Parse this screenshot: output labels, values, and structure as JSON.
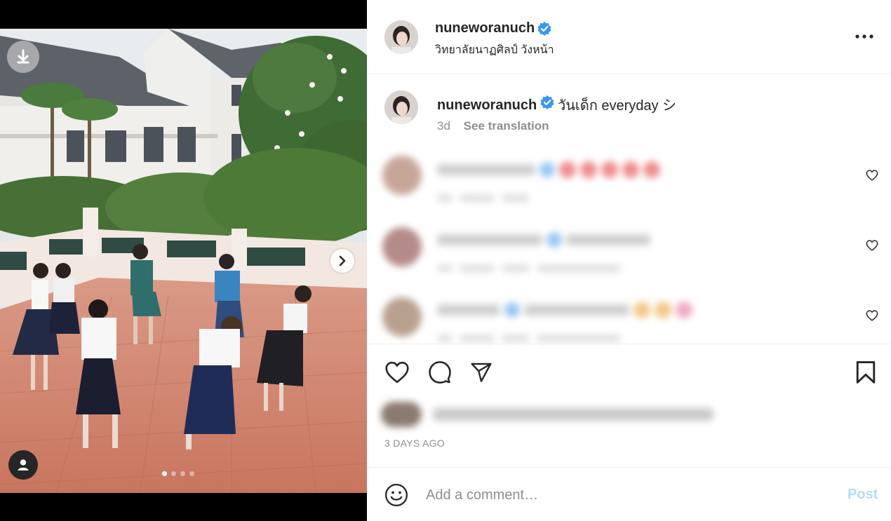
{
  "post": {
    "username": "nuneworanuch",
    "location": "วิทยาลัยนาฏศิลป์ วังหน้า",
    "caption": "วันเด็ก everyday シ",
    "time": "3d",
    "see_translation": "See translation",
    "posted_ago": "3 DAYS AGO"
  },
  "media": {
    "carousel_count": 4,
    "active_index": 0
  },
  "comment_box": {
    "placeholder": "Add a comment…",
    "post_label": "Post"
  },
  "colors": {
    "verified": "#3897f0",
    "post_disabled": "#b3dbff",
    "muted": "#8e8e8e",
    "text": "#262626"
  },
  "icons": [
    "download-icon",
    "chevron-right-icon",
    "user-tag-icon",
    "more-icon",
    "verified-icon",
    "heart-icon",
    "comment-icon",
    "share-icon",
    "bookmark-icon",
    "smile-icon"
  ]
}
